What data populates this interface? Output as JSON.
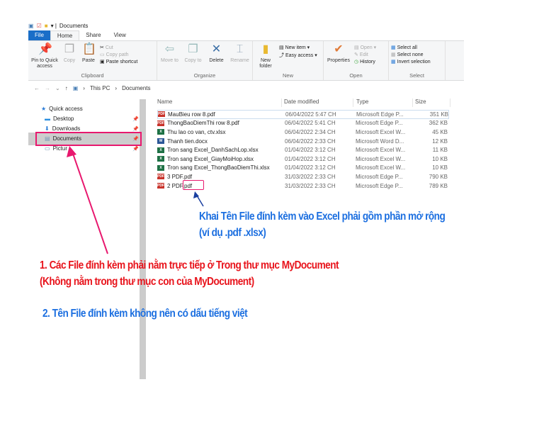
{
  "window": {
    "title": "Documents"
  },
  "tabs": [
    "File",
    "Home",
    "Share",
    "View"
  ],
  "ribbon": {
    "clipboard": {
      "label": "Clipboard",
      "pin": "Pin to Quick access",
      "copy": "Copy",
      "paste": "Paste",
      "cut": "Cut",
      "copy_path": "Copy path",
      "paste_shortcut": "Paste shortcut"
    },
    "organize": {
      "label": "Organize",
      "move_to": "Move to",
      "copy_to": "Copy to",
      "delete": "Delete",
      "rename": "Rename"
    },
    "new": {
      "label": "New",
      "new_folder": "New folder",
      "new_item": "New item ▾",
      "easy_access": "Easy access ▾"
    },
    "open": {
      "label": "Open",
      "properties": "Properties",
      "open": "Open ▾",
      "edit": "Edit",
      "history": "History"
    },
    "select": {
      "label": "Select",
      "select_all": "Select all",
      "select_none": "Select none",
      "invert": "Invert selection"
    }
  },
  "address": {
    "this_pc": "This PC",
    "documents": "Documents"
  },
  "nav": {
    "quick_access": "Quick access",
    "items": [
      "Desktop",
      "Downloads",
      "Documents",
      "Pictur"
    ]
  },
  "columns": [
    "Name",
    "Date modified",
    "Type",
    "Size"
  ],
  "files": [
    {
      "name": "MauBieu row 8.pdf",
      "date": "06/04/2022 5:47 CH",
      "type": "Microsoft Edge P...",
      "size": "351 KB",
      "kind": "pdf"
    },
    {
      "name": "ThongBaoDiemThi row 8.pdf",
      "date": "06/04/2022 5:41 CH",
      "type": "Microsoft Edge P...",
      "size": "362 KB",
      "kind": "pdf"
    },
    {
      "name": "Thu lao co van, ctv.xlsx",
      "date": "06/04/2022 2:34 CH",
      "type": "Microsoft Excel W...",
      "size": "45 KB",
      "kind": "xls"
    },
    {
      "name": "Thanh tien.docx",
      "date": "06/04/2022 2:33 CH",
      "type": "Microsoft Word D...",
      "size": "12 KB",
      "kind": "doc"
    },
    {
      "name": "Tron sang Excel_DanhSachLop.xlsx",
      "date": "01/04/2022 3:12 CH",
      "type": "Microsoft Excel W...",
      "size": "11 KB",
      "kind": "xls"
    },
    {
      "name": "Tron sang Excel_GiayMoiHop.xlsx",
      "date": "01/04/2022 3:12 CH",
      "type": "Microsoft Excel W...",
      "size": "10 KB",
      "kind": "xls"
    },
    {
      "name": "Tron sang Excel_ThongBaoDiemThi.xlsx",
      "date": "01/04/2022 3:12 CH",
      "type": "Microsoft Excel W...",
      "size": "10 KB",
      "kind": "xls"
    },
    {
      "name": "3 PDF.pdf",
      "date": "31/03/2022 2:33 CH",
      "type": "Microsoft Edge P...",
      "size": "790 KB",
      "kind": "pdf"
    },
    {
      "name": "2 PDF.pdf",
      "date": "31/03/2022 2:33 CH",
      "type": "Microsoft Edge P...",
      "size": "789 KB",
      "kind": "pdf"
    }
  ],
  "notes": {
    "ext_line1": "Khai Tên File đính kèm vào Excel phải gồm phần mở rộng",
    "ext_line2": "(ví dụ .pdf .xlsx)",
    "rule1_line1": "1. Các File đính kèm phải nằm trực tiếp ở Trong thư mục MyDocument",
    "rule1_line2": "(Không nằm trong thư mục con của MyDocument)",
    "rule2": "2. Tên File đính kèm không nên có dấu tiếng việt"
  },
  "colors": {
    "accent": "#1a6ec8",
    "annotation_pink": "#e8186e",
    "note_blue": "#1c6fe0",
    "note_red": "#e8141c"
  }
}
